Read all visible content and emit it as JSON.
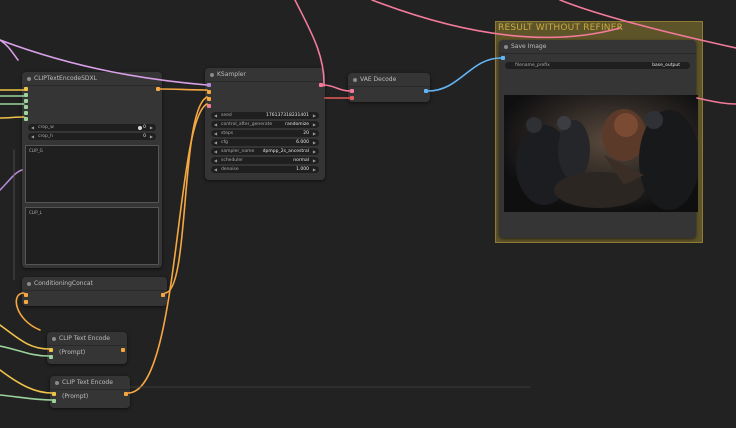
{
  "group": {
    "title": "RESULT WITHOUT REFINER"
  },
  "nodes": {
    "clip_sdxl": {
      "title": "CLIPTextEncodeSDXL",
      "widgets": [
        {
          "label": "crop_w",
          "value": "0"
        },
        {
          "label": "crop_h",
          "value": "0"
        }
      ],
      "text_g_label": "CLIP_G",
      "text_l_label": "CLIP_L"
    },
    "ksampler": {
      "title": "KSampler",
      "widgets": [
        {
          "label": "seed",
          "value": "176137318231401"
        },
        {
          "label": "control_after_generate",
          "value": "randomize"
        },
        {
          "label": "steps",
          "value": "20"
        },
        {
          "label": "cfg",
          "value": "6.000"
        },
        {
          "label": "sampler_name",
          "value": "dpmpp_2s_ancestral"
        },
        {
          "label": "scheduler",
          "value": "normal"
        },
        {
          "label": "denoise",
          "value": "1.000"
        }
      ]
    },
    "vae_decode": {
      "title": "VAE Decode"
    },
    "save_image": {
      "title": "Save Image",
      "filename_label": "filename_prefix",
      "filename_value": "base_output"
    },
    "conditioning_concat": {
      "title": "ConditioningConcat"
    },
    "clip_prompt_1": {
      "title": "CLIP Text Encode (Prompt)"
    },
    "clip_prompt_2": {
      "title": "CLIP Text Encode (Prompt)"
    }
  },
  "colors": {
    "canvas": "#222222",
    "node": "#353535",
    "group": "#5e5429",
    "wire_conditioning": "#f5a742",
    "wire_clip": "#f0c24a",
    "wire_model": "#b38ad6",
    "wire_latent": "#f27a9b",
    "wire_image": "#64b5f6",
    "wire_vae": "#e85c5c",
    "wire_green": "#9bd39b"
  }
}
